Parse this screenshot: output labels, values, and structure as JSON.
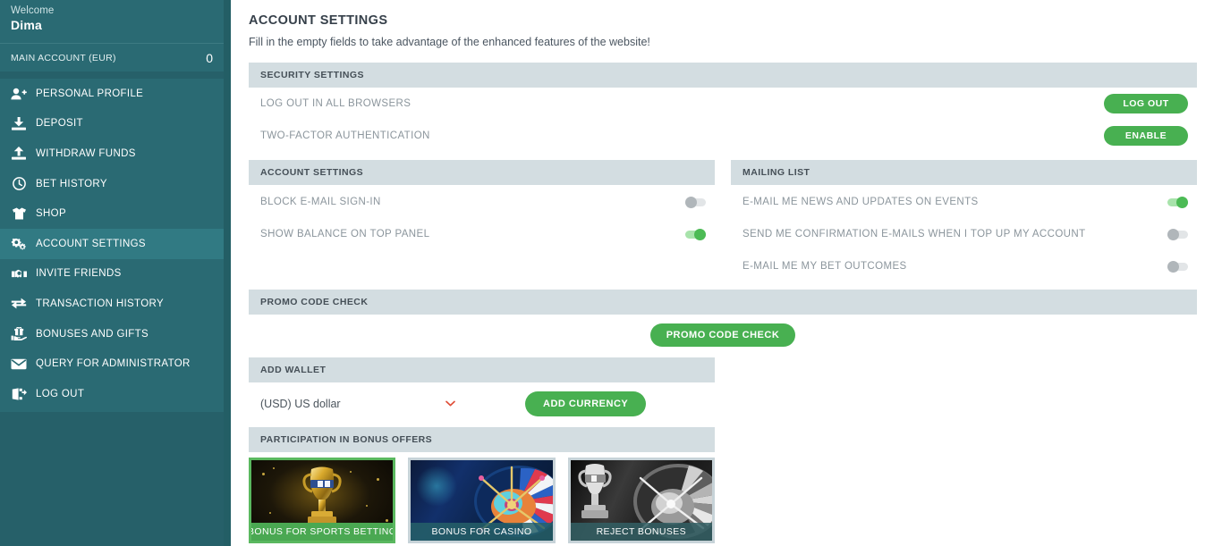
{
  "sidebar": {
    "welcome_label": "Welcome",
    "user_name": "Dima",
    "account_label": "MAIN ACCOUNT (EUR)",
    "account_balance": "0",
    "items": [
      {
        "label": "PERSONAL PROFILE",
        "icon": "user-plus-icon",
        "active": false
      },
      {
        "label": "DEPOSIT",
        "icon": "download-icon",
        "active": false
      },
      {
        "label": "WITHDRAW FUNDS",
        "icon": "upload-icon",
        "active": false
      },
      {
        "label": "BET HISTORY",
        "icon": "clock-icon",
        "active": false
      },
      {
        "label": "SHOP",
        "icon": "tshirt-icon",
        "active": false
      },
      {
        "label": "ACCOUNT SETTINGS",
        "icon": "gears-icon",
        "active": true
      },
      {
        "label": "INVITE FRIENDS",
        "icon": "handshake-icon",
        "active": false
      },
      {
        "label": "TRANSACTION HISTORY",
        "icon": "exchange-icon",
        "active": false
      },
      {
        "label": "BONUSES AND GIFTS",
        "icon": "hand-holding-gift-icon",
        "active": false
      },
      {
        "label": "QUERY FOR ADMINISTRATOR",
        "icon": "envelope-icon",
        "active": false
      },
      {
        "label": "LOG OUT",
        "icon": "sign-out-icon",
        "active": false
      }
    ]
  },
  "main": {
    "page_title": "ACCOUNT SETTINGS",
    "page_subtitle": "Fill in the empty fields to take advantage of the enhanced features of the website!",
    "security": {
      "header": "SECURITY SETTINGS",
      "rows": [
        {
          "label": "LOG OUT IN ALL BROWSERS",
          "button": "LOG OUT"
        },
        {
          "label": "TWO-FACTOR AUTHENTICATION",
          "button": "ENABLE"
        }
      ]
    },
    "account_settings": {
      "header": "ACCOUNT SETTINGS",
      "rows": [
        {
          "label": "BLOCK E-MAIL SIGN-IN",
          "state": "off"
        },
        {
          "label": "SHOW BALANCE ON TOP PANEL",
          "state": "on"
        }
      ]
    },
    "mailing_list": {
      "header": "MAILING LIST",
      "rows": [
        {
          "label": "E-MAIL ME NEWS AND UPDATES ON EVENTS",
          "state": "on"
        },
        {
          "label": "SEND ME CONFIRMATION E-MAILS WHEN I TOP UP MY ACCOUNT",
          "state": "off"
        },
        {
          "label": "E-MAIL ME MY BET OUTCOMES",
          "state": "off"
        }
      ]
    },
    "promo": {
      "header": "PROMO CODE CHECK",
      "button": "PROMO CODE CHECK"
    },
    "wallet": {
      "header": "ADD WALLET",
      "currency_value": "(USD) US dollar",
      "chevron": "chevron-down-icon",
      "button": "ADD CURRENCY"
    },
    "bonus": {
      "header": "PARTICIPATION IN BONUS OFFERS",
      "cards": [
        {
          "caption": "BONUS FOR SPORTS BETTING",
          "art": "trophy-gold",
          "selected": true
        },
        {
          "caption": "BONUS FOR CASINO",
          "art": "roulette-colour",
          "selected": false
        },
        {
          "caption": "REJECT BONUSES",
          "art": "greyscale-mix",
          "selected": false
        }
      ]
    }
  },
  "colors": {
    "sidebar_bg": "#266069",
    "sidebar_panel": "#2a6a73",
    "sidebar_active": "#317a83",
    "accent_green": "#48b051",
    "section_header": "#d3dde1",
    "text_muted": "#8b959c",
    "chevron_red": "#e0503a"
  }
}
